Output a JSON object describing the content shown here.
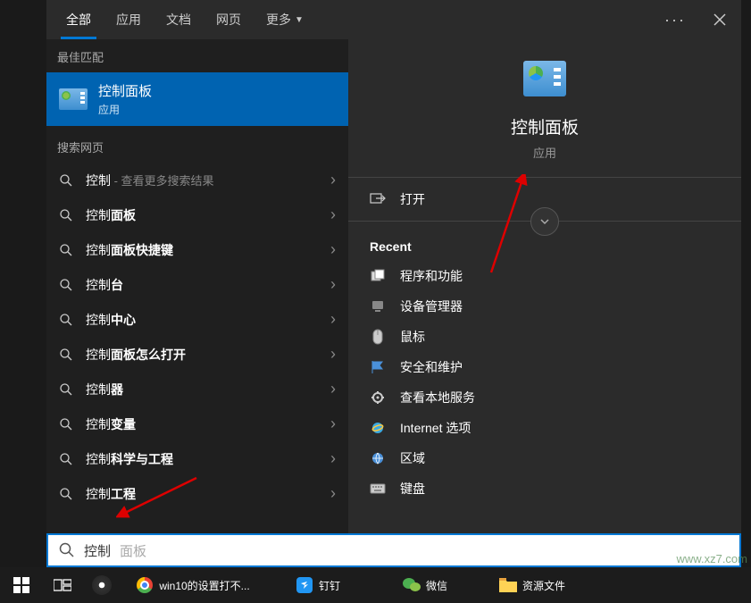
{
  "tabs": {
    "all": "全部",
    "apps": "应用",
    "docs": "文档",
    "web": "网页",
    "more": "更多"
  },
  "sections": {
    "best_match": "最佳匹配",
    "web_search": "搜索网页"
  },
  "best_match_item": {
    "title": "控制面板",
    "subtitle": "应用"
  },
  "results": [
    {
      "pre": "控制",
      "bold": "",
      "post": " - 查看更多搜索结果",
      "hint": true
    },
    {
      "pre": "控制",
      "bold": "面板",
      "post": ""
    },
    {
      "pre": "控制",
      "bold": "面板快捷键",
      "post": ""
    },
    {
      "pre": "控制",
      "bold": "台",
      "post": ""
    },
    {
      "pre": "控制",
      "bold": "中心",
      "post": ""
    },
    {
      "pre": "控制",
      "bold": "面板怎么打开",
      "post": ""
    },
    {
      "pre": "控制",
      "bold": "器",
      "post": ""
    },
    {
      "pre": "控制",
      "bold": "变量",
      "post": ""
    },
    {
      "pre": "控制",
      "bold": "科学与工程",
      "post": ""
    },
    {
      "pre": "控制",
      "bold": "工程",
      "post": ""
    }
  ],
  "preview": {
    "title": "控制面板",
    "subtitle": "应用",
    "open_action": "打开",
    "recent_header": "Recent",
    "recent": [
      {
        "icon": "programs",
        "label": "程序和功能"
      },
      {
        "icon": "device",
        "label": "设备管理器"
      },
      {
        "icon": "mouse",
        "label": "鼠标"
      },
      {
        "icon": "flag",
        "label": "安全和维护"
      },
      {
        "icon": "tools",
        "label": "查看本地服务"
      },
      {
        "icon": "ie",
        "label": "Internet 选项"
      },
      {
        "icon": "globe",
        "label": "区域"
      },
      {
        "icon": "keyboard",
        "label": "键盘"
      }
    ]
  },
  "search": {
    "value": "控制",
    "completion": "面板"
  },
  "taskbar": [
    {
      "icon": "start",
      "label": ""
    },
    {
      "icon": "taskview",
      "label": ""
    },
    {
      "icon": "browser",
      "label": ""
    },
    {
      "icon": "chrome",
      "label": "win10的设置打不..."
    },
    {
      "icon": "dingtalk",
      "label": "钉钉"
    },
    {
      "icon": "wechat",
      "label": "微信"
    },
    {
      "icon": "folder",
      "label": "资源文件"
    }
  ],
  "watermark": "www.xz7.com"
}
